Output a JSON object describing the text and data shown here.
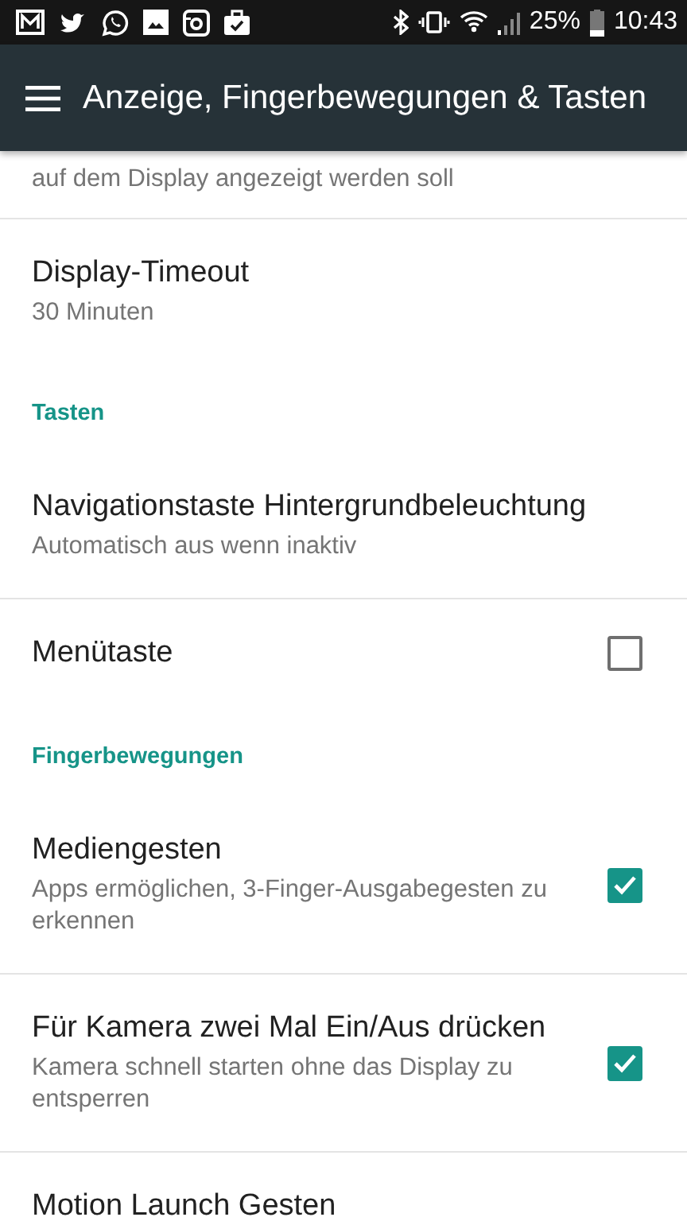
{
  "status_bar": {
    "battery": "25%",
    "time": "10:43"
  },
  "app_bar": {
    "title": "Anzeige, Fingerbewegungen & Tasten"
  },
  "items": [
    {
      "kind": "partial",
      "summary": "auf dem Display angezeigt werden soll"
    },
    {
      "kind": "setting",
      "title": "Display-Timeout",
      "summary": "30 Minuten"
    },
    {
      "kind": "header",
      "title": "Tasten"
    },
    {
      "kind": "setting",
      "title": "Navigationstaste Hintergrundbeleuchtung",
      "summary": "Automatisch aus wenn inaktiv"
    },
    {
      "kind": "checkbox",
      "title": "Menütaste",
      "checked": false
    },
    {
      "kind": "header",
      "title": "Fingerbewegungen"
    },
    {
      "kind": "checkbox",
      "title": "Mediengesten",
      "summary": "Apps ermöglichen, 3-Finger-Ausgabegesten zu erkennen",
      "checked": true
    },
    {
      "kind": "checkbox",
      "title": "Für Kamera zwei Mal Ein/Aus drücken",
      "summary": "Kamera schnell starten ohne das Display zu entsperren",
      "checked": true
    },
    {
      "kind": "setting",
      "title": "Motion Launch Gesten"
    }
  ]
}
